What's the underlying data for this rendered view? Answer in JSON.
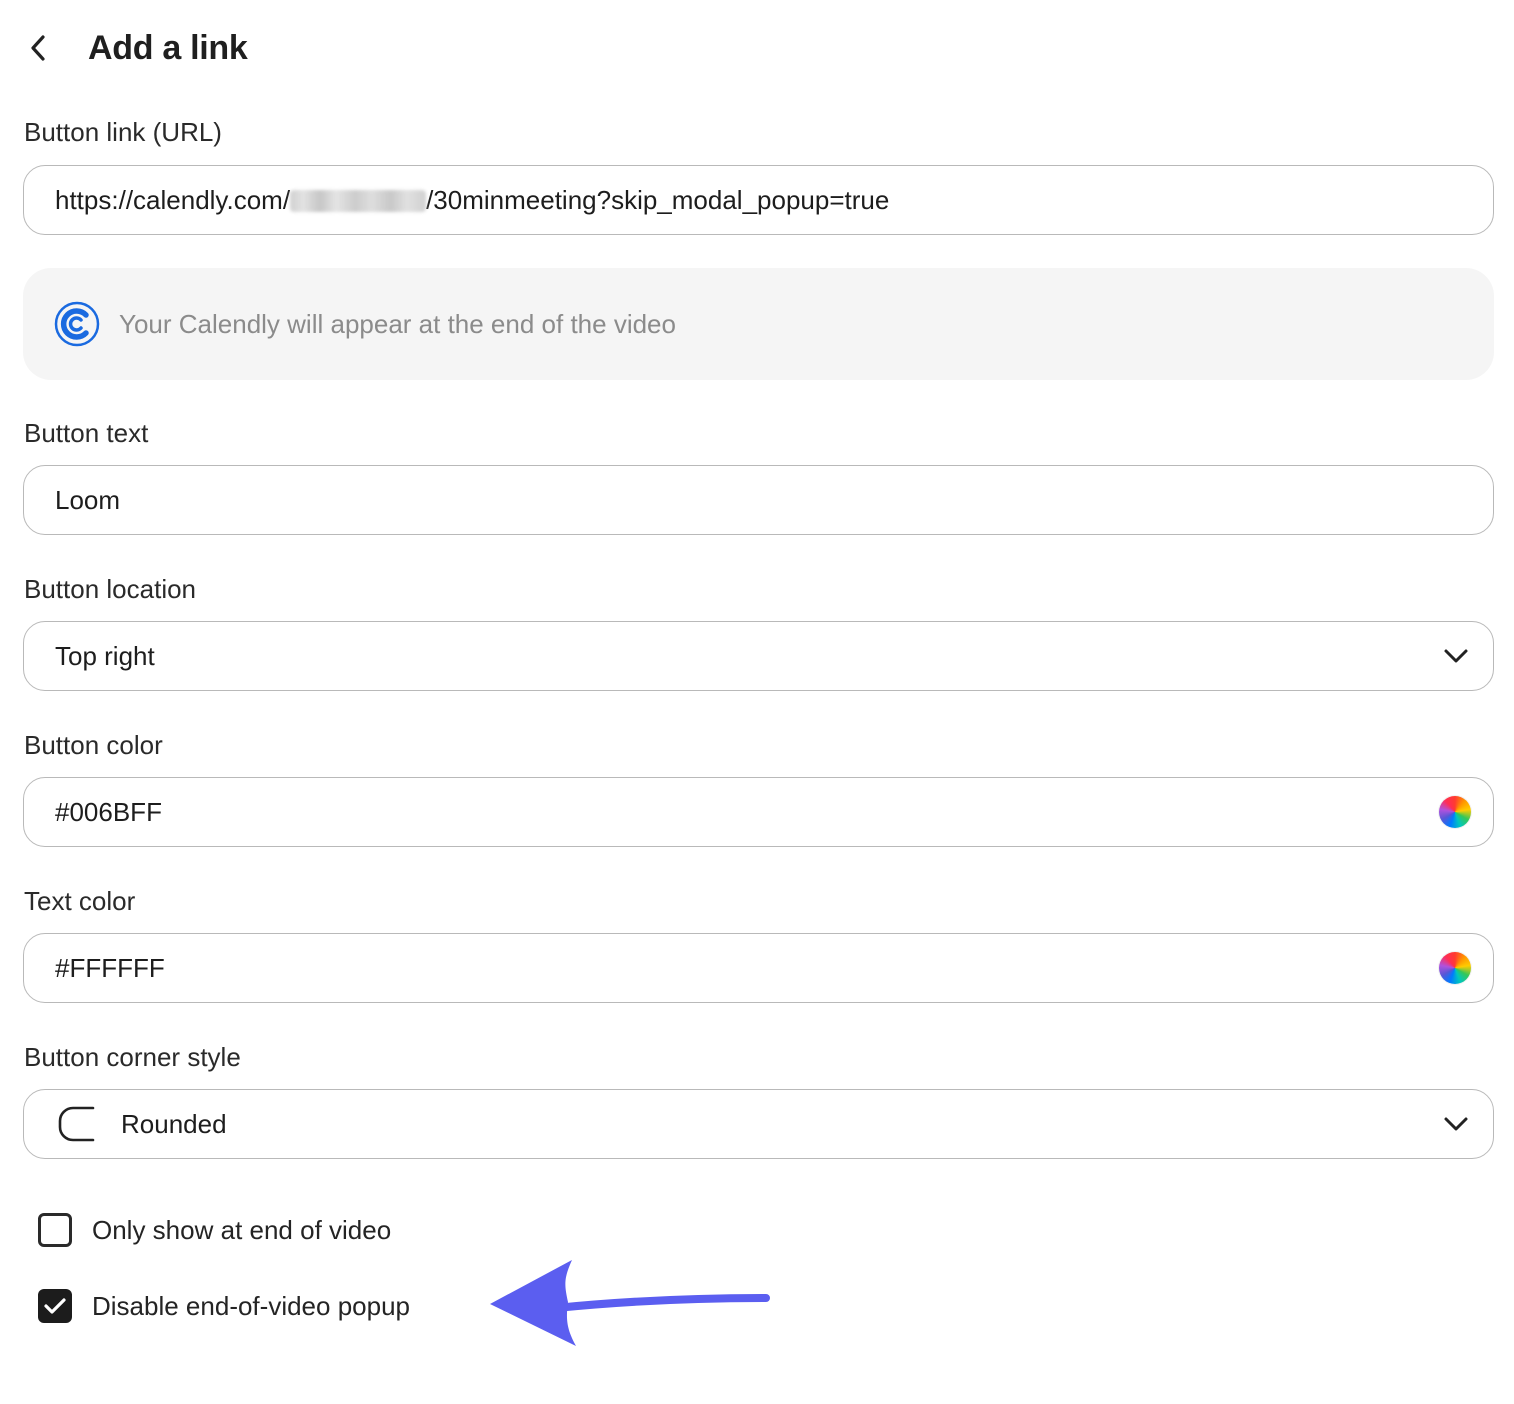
{
  "header": {
    "title": "Add a link",
    "back_icon": "chevron-left-icon"
  },
  "fields": {
    "button_link": {
      "label": "Button link (URL)",
      "value_prefix": "https://calendly.com/",
      "value_suffix": "/30minmeeting?skip_modal_popup=true"
    },
    "calendly_notice": {
      "text": "Your Calendly will appear at the end of the video",
      "icon": "calendly-logo-icon",
      "icon_color": "#1a6ae0"
    },
    "button_text": {
      "label": "Button text",
      "value": "Loom"
    },
    "button_location": {
      "label": "Button location",
      "value": "Top right"
    },
    "button_color": {
      "label": "Button color",
      "value": "#006BFF"
    },
    "text_color": {
      "label": "Text color",
      "value": "#FFFFFF"
    },
    "corner_style": {
      "label": "Button corner style",
      "value": "Rounded"
    }
  },
  "options": {
    "only_show_end": {
      "label": "Only show at end of video",
      "checked": false
    },
    "disable_popup": {
      "label": "Disable end-of-video popup",
      "checked": true
    }
  },
  "annotation": {
    "arrow_color": "#5b5ef0"
  }
}
